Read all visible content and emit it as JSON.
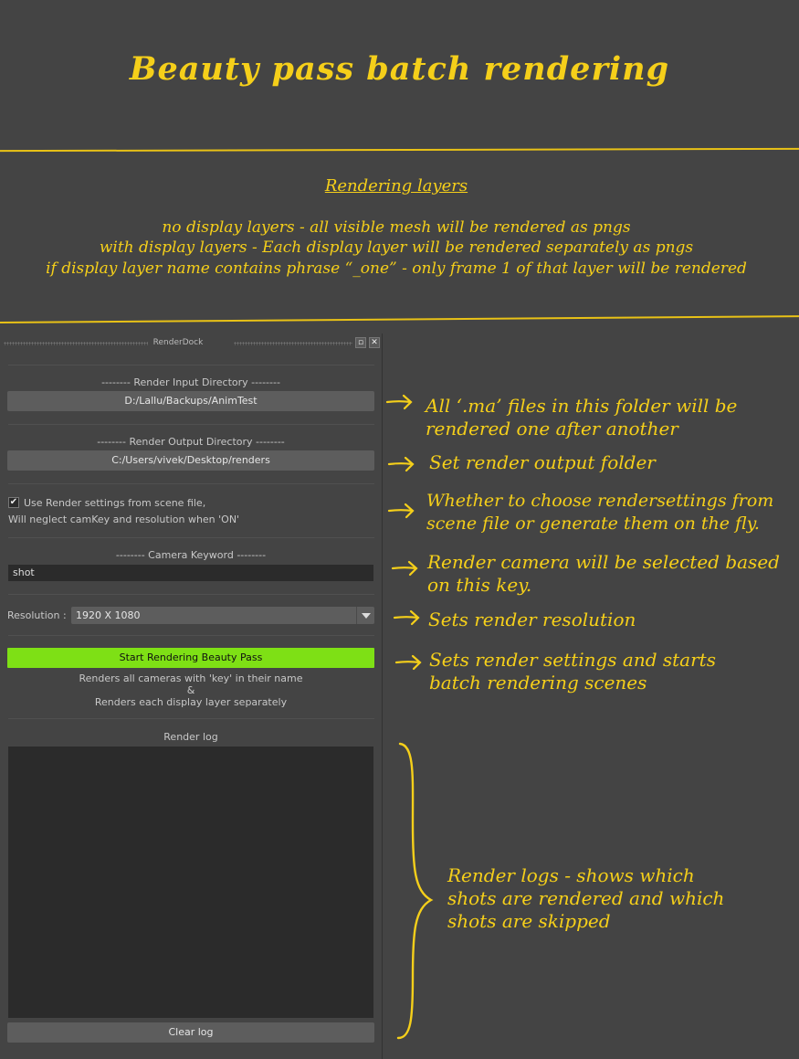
{
  "header": {
    "title": "Beauty pass batch rendering",
    "layers_heading": "Rendering layers",
    "layer_lines": [
      "no display layers - all visible mesh will be rendered as pngs",
      "with display layers - Each display layer will be rendered separately as pngs",
      "if display layer name contains phrase “_one” - only frame 1 of that layer will be rendered"
    ]
  },
  "dock": {
    "title": "RenderDock",
    "input_dir_label": "-------- Render Input Directory --------",
    "input_dir_value": "D:/Lallu/Backups/AnimTest",
    "output_dir_label": "-------- Render Output Directory --------",
    "output_dir_value": "C:/Users/vivek/Desktop/renders",
    "use_scene_settings_label": "Use Render settings from scene file,",
    "use_scene_settings_note": "Will neglect camKey and resolution when 'ON'",
    "use_scene_settings_checked": "✔",
    "camera_keyword_label": "-------- Camera Keyword --------",
    "camera_keyword_value": "shot",
    "resolution_label": "Resolution :",
    "resolution_value": "1920 X 1080",
    "start_button_label": "Start Rendering Beauty Pass",
    "start_note_1": "Renders all cameras with 'key' in their name",
    "start_note_amp": "&",
    "start_note_2": "Renders each display layer separately",
    "render_log_label": "Render log",
    "clear_log_label": "Clear log"
  },
  "annotations": {
    "input_dir": [
      "All ‘.ma’ files in this folder will be",
      "rendered one after another"
    ],
    "output_dir": [
      "Set render output folder"
    ],
    "scene_settings": [
      "Whether to choose rendersettings from",
      "scene file or generate them on the fly."
    ],
    "camera_key": [
      "Render camera will be selected based",
      "on this key."
    ],
    "resolution": [
      "Sets render resolution"
    ],
    "start": [
      "Sets render settings and starts",
      "batch rendering scenes"
    ],
    "log": [
      "Render logs - shows which",
      "shots are rendered and which",
      "shots are skipped"
    ]
  },
  "colors": {
    "background": "#444444",
    "annotation": "#f5cf1a",
    "start_button": "#7ee015",
    "field": "#2b2b2b",
    "button": "#5d5d5d"
  },
  "icons": {
    "float": "float-window-icon",
    "close": "close-icon",
    "dropdown": "chevron-down-icon"
  }
}
